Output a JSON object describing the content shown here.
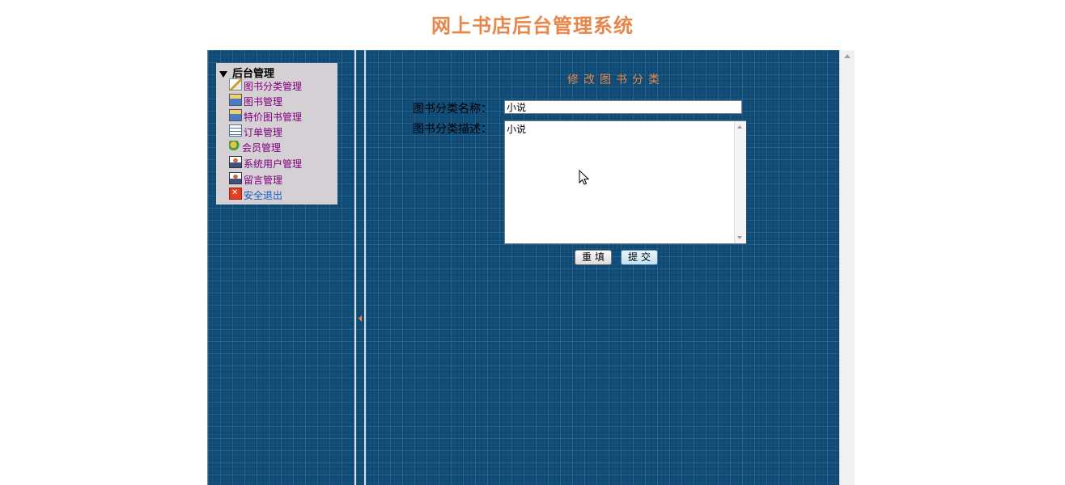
{
  "header": {
    "title": "网上书店后台管理系统"
  },
  "menu": {
    "header": "后台管理",
    "items": [
      {
        "label": "图书分类管理",
        "icon": "edit-icon"
      },
      {
        "label": "图书管理",
        "icon": "folder-icon"
      },
      {
        "label": "特价图书管理",
        "icon": "folder-icon"
      },
      {
        "label": "订单管理",
        "icon": "list-icon"
      },
      {
        "label": "会员管理",
        "icon": "users-icon"
      },
      {
        "label": "系统用户管理",
        "icon": "person-icon"
      },
      {
        "label": "留言管理",
        "icon": "person-icon"
      },
      {
        "label": "安全退出",
        "icon": "exit-icon"
      }
    ]
  },
  "form": {
    "title": "修改图书分类",
    "name_label": "图书分类名称：",
    "name_value": "小说",
    "desc_label": "图书分类描述：",
    "desc_value": "小说",
    "reset_label": "重填",
    "submit_label": "提交"
  },
  "colors": {
    "accent": "#e8864a",
    "panel_bg": "#0f4a74",
    "menu_bg": "#d4d0d4",
    "link": "#800080"
  }
}
